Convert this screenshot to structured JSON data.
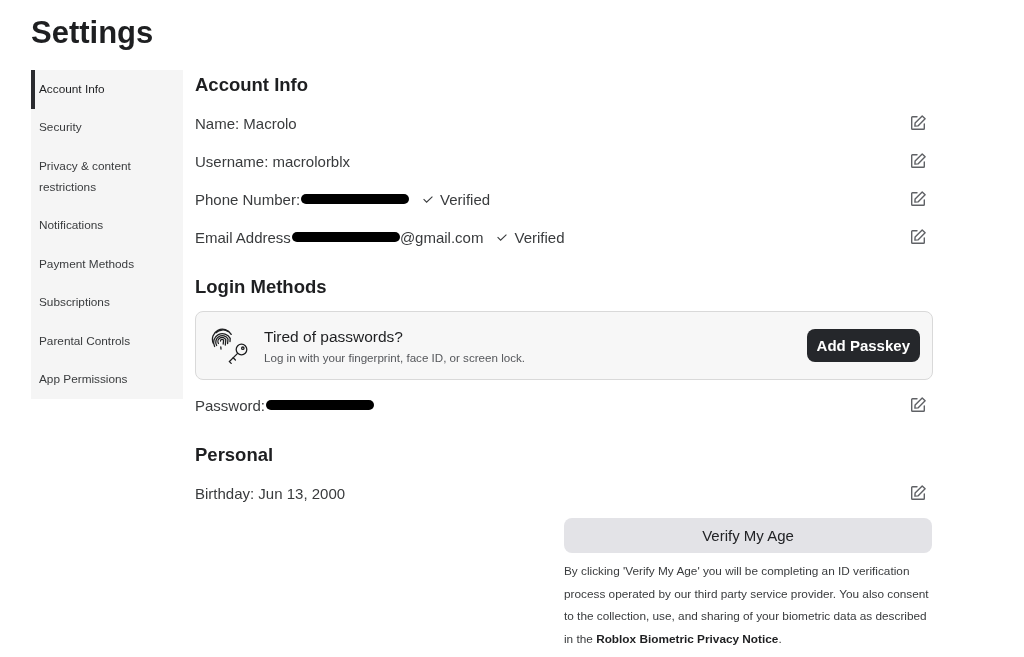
{
  "title": "Settings",
  "sidebar": {
    "items": [
      {
        "label": "Account Info",
        "selected": true
      },
      {
        "label": "Security",
        "selected": false
      },
      {
        "label": "Privacy & content restrictions",
        "selected": false
      },
      {
        "label": "Notifications",
        "selected": false
      },
      {
        "label": "Payment Methods",
        "selected": false
      },
      {
        "label": "Subscriptions",
        "selected": false
      },
      {
        "label": "Parental Controls",
        "selected": false
      },
      {
        "label": "App Permissions",
        "selected": false
      }
    ]
  },
  "sections": [
    {
      "heading": "Account Info",
      "rows": [
        {
          "text": "Name: Macrolo",
          "redacted": false
        },
        {
          "text": "Username: macrolorblx",
          "redacted": false
        },
        {
          "text": "Phone Number:",
          "redacted": true,
          "status": "Verified"
        },
        {
          "text": "Email Address",
          "redacted": true,
          "suffix": "@gmail.com",
          "status": "Verified"
        }
      ]
    },
    {
      "heading": "Login Methods",
      "passkey_card": {
        "title": "Tired of passwords?",
        "subtitle": "Log in with your fingerprint, face ID, or screen lock.",
        "button": "Add Passkey"
      },
      "rows": [
        {
          "text": "Password:",
          "redacted": true
        }
      ]
    },
    {
      "heading": "Personal",
      "rows": [
        {
          "text": "Birthday: Jun 13, 2000",
          "redacted": false
        }
      ],
      "verify_button": "Verify My Age",
      "notice": {
        "text": "By clicking 'Verify My Age' you will be completing an ID verification process operated by our third party service provider. You also consent to the collection, use, and sharing of your biometric data as described in the",
        "link": "Roblox Biometric Privacy Notice",
        "end": "."
      }
    }
  ]
}
